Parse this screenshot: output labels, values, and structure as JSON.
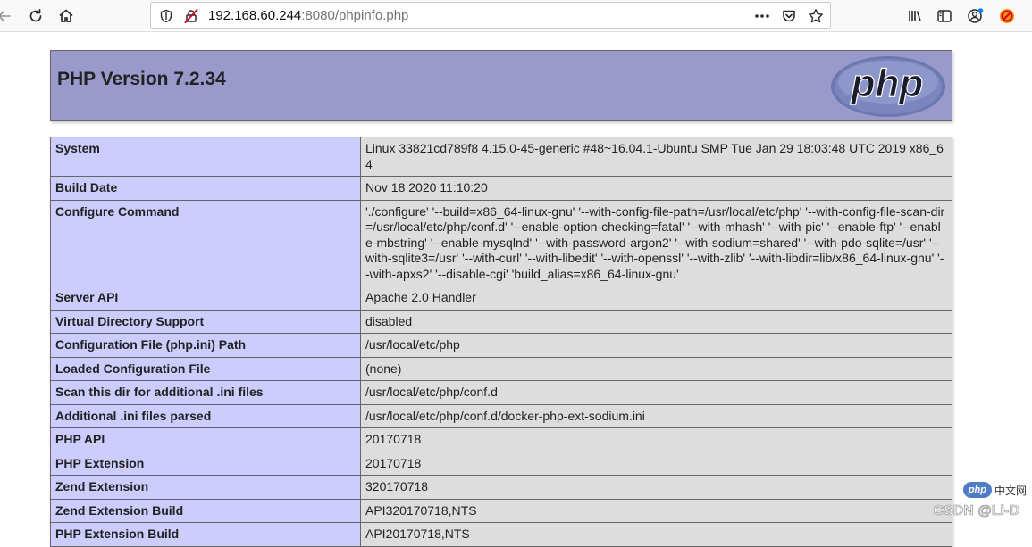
{
  "browser": {
    "url_host": "192.168.60.244",
    "url_rest": ":8080/phpinfo.php",
    "icons": {
      "back": "arrow-left-icon",
      "reload": "reload-icon",
      "home": "home-icon",
      "shield": "shield-icon",
      "insecure": "insecure-lock-icon",
      "more": "more-dots-icon",
      "pocket": "pocket-icon",
      "bookmark": "star-icon",
      "library": "library-icon",
      "sidebar": "sidebar-icon",
      "account": "account-icon",
      "extension": "blocked-extension-icon"
    }
  },
  "header": {
    "title": "PHP Version 7.2.34",
    "logo_text": "php"
  },
  "rows": [
    {
      "key": "System",
      "value": "Linux 33821cd789f8 4.15.0-45-generic #48~16.04.1-Ubuntu SMP Tue Jan 29 18:03:48 UTC 2019 x86_64"
    },
    {
      "key": "Build Date",
      "value": "Nov 18 2020 11:10:20"
    },
    {
      "key": "Configure Command",
      "value": "'./configure' '--build=x86_64-linux-gnu' '--with-config-file-path=/usr/local/etc/php' '--with-config-file-scan-dir=/usr/local/etc/php/conf.d' '--enable-option-checking=fatal' '--with-mhash' '--with-pic' '--enable-ftp' '--enable-mbstring' '--enable-mysqlnd' '--with-password-argon2' '--with-sodium=shared' '--with-pdo-sqlite=/usr' '--with-sqlite3=/usr' '--with-curl' '--with-libedit' '--with-openssl' '--with-zlib' '--with-libdir=lib/x86_64-linux-gnu' '--with-apxs2' '--disable-cgi' 'build_alias=x86_64-linux-gnu'"
    },
    {
      "key": "Server API",
      "value": "Apache 2.0 Handler"
    },
    {
      "key": "Virtual Directory Support",
      "value": "disabled"
    },
    {
      "key": "Configuration File (php.ini) Path",
      "value": "/usr/local/etc/php"
    },
    {
      "key": "Loaded Configuration File",
      "value": "(none)"
    },
    {
      "key": "Scan this dir for additional .ini files",
      "value": "/usr/local/etc/php/conf.d"
    },
    {
      "key": "Additional .ini files parsed",
      "value": "/usr/local/etc/php/conf.d/docker-php-ext-sodium.ini"
    },
    {
      "key": "PHP API",
      "value": "20170718"
    },
    {
      "key": "PHP Extension",
      "value": "20170718"
    },
    {
      "key": "Zend Extension",
      "value": "320170718"
    },
    {
      "key": "Zend Extension Build",
      "value": "API320170718,NTS"
    },
    {
      "key": "PHP Extension Build",
      "value": "API20170718,NTS"
    }
  ],
  "watermark": {
    "badge": "php",
    "site": "中文网",
    "credit": "CSDN @Li-D"
  },
  "colors": {
    "header_bg": "#9999cc",
    "key_bg": "#ccccff",
    "value_bg": "#dddddd",
    "border": "#666666"
  }
}
